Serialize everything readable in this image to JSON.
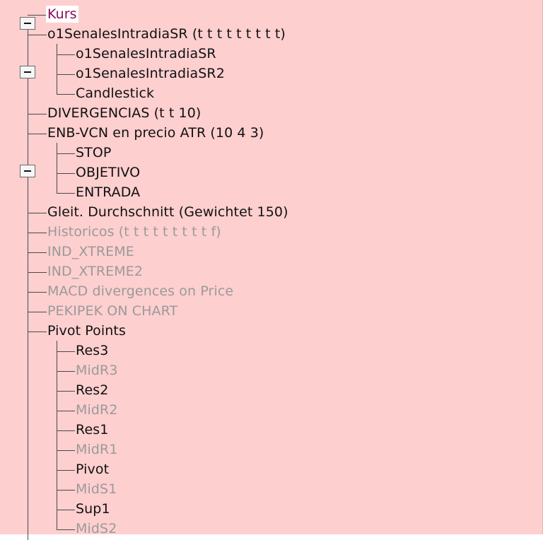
{
  "tree": {
    "root": {
      "label": "Kurs"
    },
    "items": [
      {
        "label": "o1SenalesIntradiaSR (t t t t t t t t t)",
        "level": 1,
        "enabled": true,
        "expanded": true,
        "children": [
          {
            "label": "o1SenalesIntradiaSR",
            "level": 2,
            "enabled": true
          },
          {
            "label": "o1SenalesIntradiaSR2",
            "level": 2,
            "enabled": true
          },
          {
            "label": "Candlestick",
            "level": 2,
            "enabled": true
          }
        ]
      },
      {
        "label": "DIVERGENCIAS (t t 10)",
        "level": 1,
        "enabled": true
      },
      {
        "label": "ENB-VCN en precio ATR (10 4 3)",
        "level": 1,
        "enabled": true,
        "expanded": true,
        "children": [
          {
            "label": "STOP",
            "level": 2,
            "enabled": true
          },
          {
            "label": "OBJETIVO",
            "level": 2,
            "enabled": true
          },
          {
            "label": "ENTRADA",
            "level": 2,
            "enabled": true
          }
        ]
      },
      {
        "label": "Gleit. Durchschnitt (Gewichtet 150)",
        "level": 1,
        "enabled": true
      },
      {
        "label": "Historicos (t t t t t t t t t f)",
        "level": 1,
        "enabled": false
      },
      {
        "label": "IND_XTREME",
        "level": 1,
        "enabled": false
      },
      {
        "label": "IND_XTREME2",
        "level": 1,
        "enabled": false
      },
      {
        "label": "MACD divergences on Price",
        "level": 1,
        "enabled": false
      },
      {
        "label": "PEKIPEK  ON CHART",
        "level": 1,
        "enabled": false
      },
      {
        "label": "Pivot Points",
        "level": 1,
        "enabled": true,
        "expanded": true,
        "children": [
          {
            "label": "Res3",
            "level": 2,
            "enabled": true
          },
          {
            "label": "MidR3",
            "level": 2,
            "enabled": false
          },
          {
            "label": "Res2",
            "level": 2,
            "enabled": true
          },
          {
            "label": "MidR2",
            "level": 2,
            "enabled": false
          },
          {
            "label": "Res1",
            "level": 2,
            "enabled": true
          },
          {
            "label": "MidR1",
            "level": 2,
            "enabled": false
          },
          {
            "label": "Pivot",
            "level": 2,
            "enabled": true
          },
          {
            "label": "MidS1",
            "level": 2,
            "enabled": false
          },
          {
            "label": "Sup1",
            "level": 2,
            "enabled": true
          },
          {
            "label": "MidS2",
            "level": 2,
            "enabled": false
          }
        ]
      }
    ]
  },
  "colors": {
    "panel_background": "#fecfcf",
    "enabled_text": "#111111",
    "disabled_text": "#9a9a9a",
    "root_text": "#8a0a5a",
    "root_background": "#ffffff",
    "tree_line": "#4a4a4a"
  },
  "icons": {
    "toggle": "minus-box-icon"
  }
}
